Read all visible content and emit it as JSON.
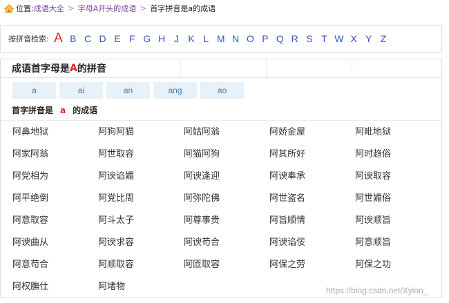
{
  "breadcrumb": {
    "position_label": "位置:",
    "home": "成语大全",
    "parent": "字母A开头的成语",
    "current": "首字拼音是a的成语"
  },
  "letter_nav": {
    "label": "按拼音检索:",
    "active": "A",
    "letters": [
      "A",
      "B",
      "C",
      "D",
      "E",
      "F",
      "G",
      "H",
      "J",
      "K",
      "L",
      "M",
      "N",
      "O",
      "P",
      "Q",
      "R",
      "S",
      "T",
      "W",
      "X",
      "Y",
      "Z"
    ]
  },
  "panel": {
    "title_prefix": "成语首字母是",
    "title_letter": "A",
    "title_suffix": "的拼音",
    "tabs": [
      "a",
      "ai",
      "an",
      "ang",
      "ao"
    ],
    "subhead_prefix": "首字拼音是",
    "subhead_pinyin": "a",
    "subhead_suffix": "的成语"
  },
  "idioms": [
    "阿鼻地狱",
    "阿狗阿猫",
    "阿姑阿翁",
    "阿娇金屋",
    "阿毗地狱",
    "阿家阿翁",
    "阿世取容",
    "阿猫阿狗",
    "阿其所好",
    "阿时趋俗",
    "阿党相为",
    "阿谀谄媚",
    "阿谀逢迎",
    "阿谀奉承",
    "阿谀取容",
    "阿平绝倒",
    "阿党比周",
    "阿弥陀佛",
    "阿世盗名",
    "阿世媚俗",
    "阿意取容",
    "阿斗太子",
    "阿尊事贵",
    "阿旨顺情",
    "阿谀顺旨",
    "阿谀曲从",
    "阿谀求容",
    "阿谀苟合",
    "阿谀谄佞",
    "阿意顺旨",
    "阿意苟合",
    "阿顺取容",
    "阿匼取容",
    "阿保之劳",
    "阿保之功",
    "阿权膴仕",
    "阿堵物"
  ],
  "watermark": "https://blog.csdn.net/Xylon_",
  "colors": {
    "link": "#3355bb",
    "active_letter": "#dd2222",
    "tab_bg": "#e7f1fa",
    "tab_text": "#4477aa",
    "breadcrumb_link": "#7a3fa0"
  }
}
